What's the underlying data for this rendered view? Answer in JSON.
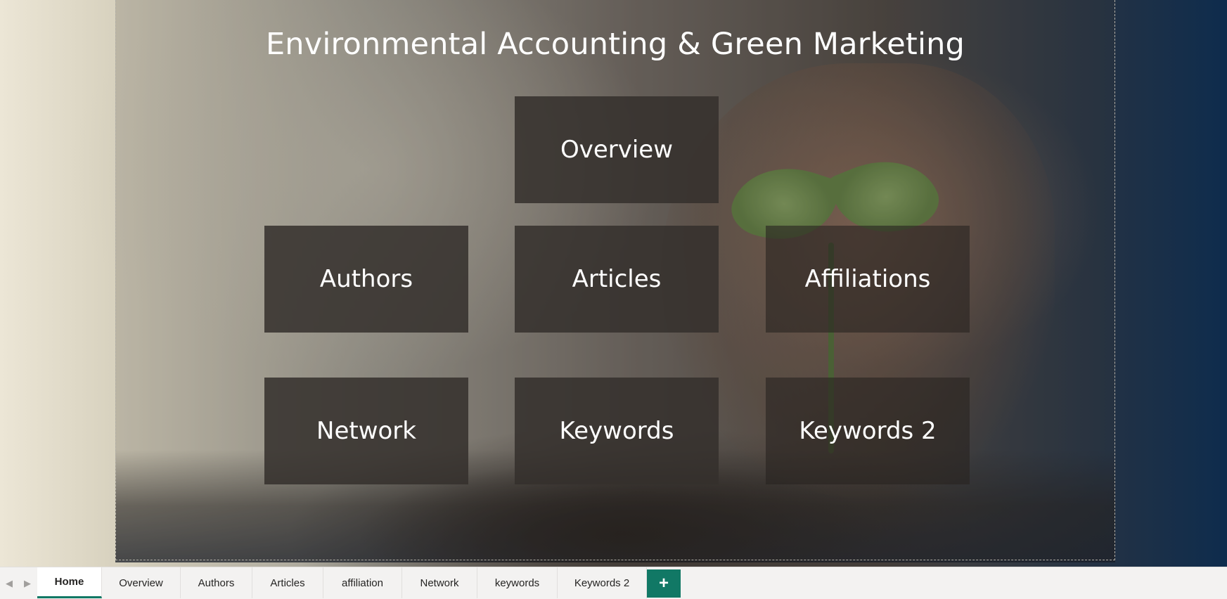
{
  "report": {
    "title": "Environmental Accounting & Green Marketing",
    "tiles": [
      {
        "label": "Overview"
      },
      {
        "label": "Authors"
      },
      {
        "label": "Articles"
      },
      {
        "label": "Affiliations"
      },
      {
        "label": "Network"
      },
      {
        "label": "Keywords"
      },
      {
        "label": "Keywords 2"
      }
    ]
  },
  "page_tabs": {
    "prev_icon": "chevron-left-icon",
    "next_icon": "chevron-right-icon",
    "tabs": [
      {
        "label": "Home",
        "active": true
      },
      {
        "label": "Overview"
      },
      {
        "label": "Authors"
      },
      {
        "label": "Articles"
      },
      {
        "label": "affiliation"
      },
      {
        "label": "Network"
      },
      {
        "label": "keywords"
      },
      {
        "label": "Keywords 2"
      }
    ],
    "add_icon": "plus-icon"
  },
  "colors": {
    "accent": "#117865",
    "tile_bg": "#34302c",
    "tab_bar_bg": "#f3f2f1"
  }
}
